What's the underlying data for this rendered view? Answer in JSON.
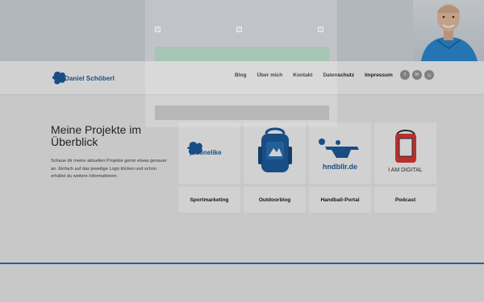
{
  "header": {
    "logo_text": "Daniel Schöberl",
    "nav": [
      "Blog",
      "Über mich",
      "Kontakt",
      "Datenschutz",
      "Impressum"
    ],
    "social": [
      {
        "icon": "twitter-icon",
        "glyph": "t"
      },
      {
        "icon": "linkedin-icon",
        "glyph": "in"
      },
      {
        "icon": "instagram-icon",
        "glyph": "◎"
      }
    ]
  },
  "intro": {
    "title": "Meine Projekte im Überblick",
    "text": "Schaue dir meine aktuellen Projekte gerne etwas genauer an. Einfach auf das jeweilige Logo klicken und schon erhältst du weitere Informationen."
  },
  "projects": [
    {
      "logo_text": "pluonelike",
      "caption": "",
      "label": "Sportmarketing"
    },
    {
      "logo_text": "",
      "caption": "",
      "label": "Outdoorblog"
    },
    {
      "logo_text": "hndbllr.de",
      "caption": "",
      "label": "Handball-Portal"
    },
    {
      "logo_text": "",
      "caption": "I AM DIGITAL",
      "label": "Podcast"
    }
  ],
  "cookie": {
    "text": "",
    "checks": [
      "",
      "",
      ""
    ],
    "accept_label": "",
    "more_link": "",
    "individual_label": ""
  },
  "colors": {
    "brand_blue": "#1e5fa3",
    "accent_line": "#2f78b6",
    "podcast_red": "#e23a3a"
  }
}
